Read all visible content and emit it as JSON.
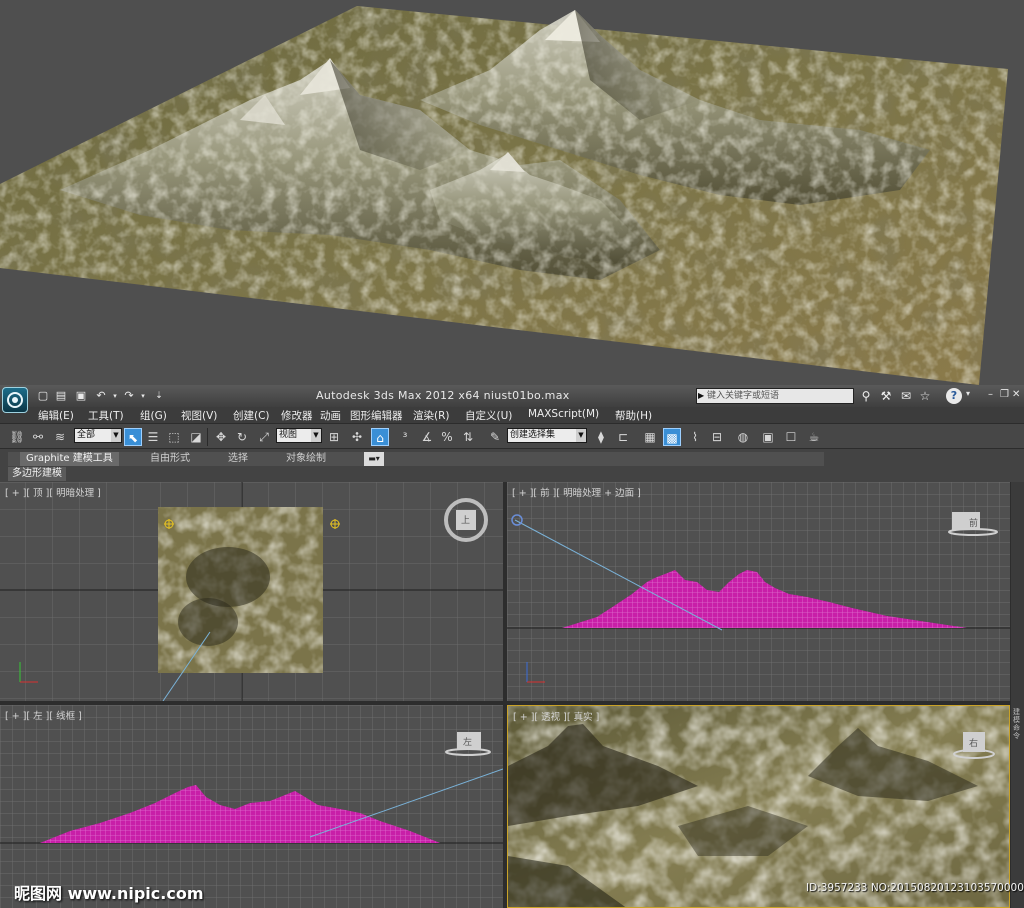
{
  "app": {
    "window_title": "Autodesk 3ds Max  2012 x64      niust01bo.max",
    "search_placeholder": "键入关键字或短语"
  },
  "menu": [
    "编辑(E)",
    "工具(T)",
    "组(G)",
    "视图(V)",
    "创建(C)",
    "修改器",
    "动画",
    "图形编辑器",
    "渲染(R)",
    "自定义(U)",
    "MAXScript(M)",
    "帮助(H)"
  ],
  "toolbar": {
    "selection_filter": "全部",
    "reference_coord": "视图",
    "named_selection_set": "创建选择集"
  },
  "ribbon": {
    "tabs": [
      "Graphite 建模工具",
      "自由形式",
      "选择",
      "对象绘制"
    ],
    "active_tab": "Graphite 建模工具",
    "panel": "多边形建模"
  },
  "viewports": {
    "top": {
      "label": "[ + ][ 顶 ][ 明暗处理 ]",
      "cube_face": "上"
    },
    "front": {
      "label": "[ + ][ 前 ][ 明暗处理 + 边面 ]",
      "cube_face": "前"
    },
    "left": {
      "label": "[ + ][ 左 ][ 线框 ]",
      "cube_face": "左"
    },
    "persp": {
      "label": "[ + ][ 透视 ][ 真实 ]",
      "cube_face": "右"
    }
  },
  "side_label": "建模命令",
  "watermark": {
    "left": "昵图网 www.nipic.com",
    "right": "ID:3957233 NO:20150820123103570000"
  },
  "colors": {
    "wireframe": "#c81fa8",
    "viewport_bg": "#505050",
    "grid": "#6c6c6c",
    "active_border": "#c9a227",
    "accent_blue": "#3a8fd6"
  }
}
